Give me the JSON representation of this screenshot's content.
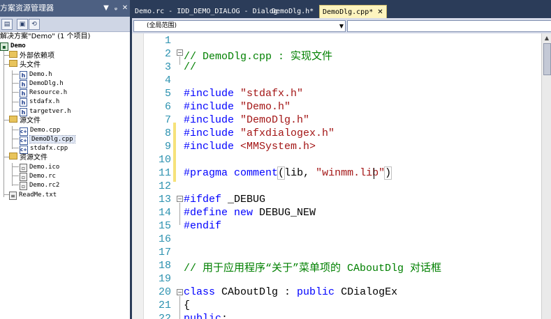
{
  "solution_explorer": {
    "title": "方案资源管理器",
    "solution": "解决方案\"Demo\" (1 个项目)",
    "project": "Demo",
    "nodes": {
      "ext_deps": "外部依赖项",
      "headers": "头文件",
      "header_files": [
        "Demo.h",
        "DemoDlg.h",
        "Resource.h",
        "stdafx.h",
        "targetver.h"
      ],
      "sources": "源文件",
      "source_files": [
        "Demo.cpp",
        "DemoDlg.cpp",
        "stdafx.cpp"
      ],
      "resources": "资源文件",
      "resource_files": [
        "Demo.ico",
        "Demo.rc",
        "Demo.rc2"
      ],
      "readme": "ReadMe.txt"
    },
    "selected_item": "DemoDlg.cpp"
  },
  "tabs": [
    {
      "label": "Demo.rc - IDD_DEMO_DIALOG - Dialog",
      "active": false
    },
    {
      "label": "DemoDlg.h*",
      "active": false
    },
    {
      "label": "DemoDlg.cpp*",
      "active": true
    }
  ],
  "nav": {
    "scope": "(全局范围)"
  },
  "editor": {
    "lines": [
      {
        "n": "1",
        "text": ""
      },
      {
        "n": "2",
        "text": "// DemoDlg.cpp : 实现文件"
      },
      {
        "n": "3",
        "text": "//"
      },
      {
        "n": "4",
        "text": ""
      },
      {
        "n": "5",
        "text": "#include \"stdafx.h\""
      },
      {
        "n": "6",
        "text": "#include \"Demo.h\""
      },
      {
        "n": "7",
        "text": "#include \"DemoDlg.h\""
      },
      {
        "n": "8",
        "text": "#include \"afxdialogex.h\""
      },
      {
        "n": "9",
        "text": "#include <MMSystem.h>"
      },
      {
        "n": "10",
        "text": ""
      },
      {
        "n": "11",
        "text": "#pragma comment(lib, \"winmm.lib\")"
      },
      {
        "n": "12",
        "text": ""
      },
      {
        "n": "13",
        "text": "#ifdef _DEBUG"
      },
      {
        "n": "14",
        "text": "#define new DEBUG_NEW"
      },
      {
        "n": "15",
        "text": "#endif"
      },
      {
        "n": "16",
        "text": ""
      },
      {
        "n": "17",
        "text": ""
      },
      {
        "n": "18",
        "text": "// 用于应用程序“关于”菜单项的 CAboutDlg 对话框"
      },
      {
        "n": "19",
        "text": ""
      },
      {
        "n": "20",
        "text": "class CAboutDlg : public CDialogEx"
      },
      {
        "n": "21",
        "text": "{"
      },
      {
        "n": "22",
        "text": "public:"
      }
    ]
  },
  "colors": {
    "frame": "#2b3c59",
    "active_tab": "#fdf4bf",
    "keyword": "#0000ff",
    "comment": "#008000",
    "string": "#a31515",
    "line_number": "#2b91af",
    "change_marker": "#f6e27a"
  }
}
